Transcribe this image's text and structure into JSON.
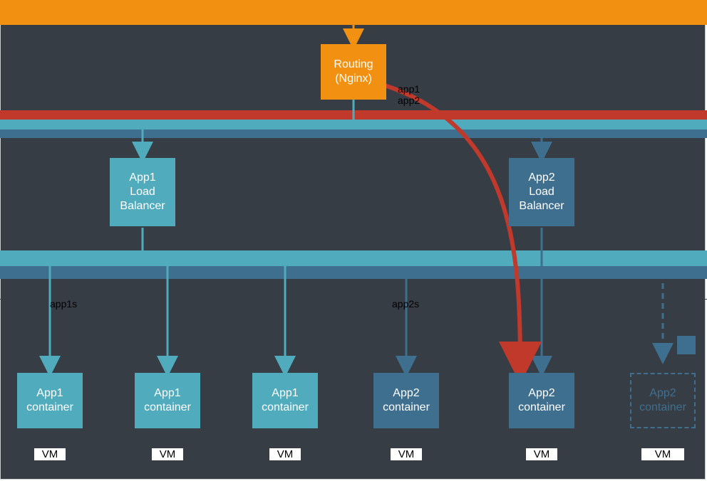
{
  "diagram": {
    "top_band": "",
    "routing": "Routing\n(Nginx)",
    "app1_lb": "App1\nLoad\nBalancer",
    "app2_lb": "App2\nLoad\nBalancer",
    "app1_container": "App1\ncontainer",
    "app2_container": "App2\ncontainer",
    "vm": "VM",
    "label_routing_right1": "app1",
    "label_routing_right2": "app2",
    "label_lb1_left": "app1s",
    "label_lb2_left": "app2s",
    "stripes": {
      "c1": "#50abbd",
      "c2": "#3f6f8f",
      "c3": "#c0392b"
    }
  },
  "chart_data": {
    "type": "diagram",
    "title": "Routing / Load-balancer / container topology",
    "nodes": [
      {
        "id": "routing",
        "label": "Routing (Nginx)",
        "color": "#f29111"
      },
      {
        "id": "app1_lb",
        "label": "App1 Load Balancer",
        "color": "#50abbd"
      },
      {
        "id": "app2_lb",
        "label": "App2 Load Balancer",
        "color": "#3f6f8f"
      },
      {
        "id": "app1_c1",
        "label": "App1 container",
        "vm": "VM",
        "color": "#50abbd"
      },
      {
        "id": "app1_c2",
        "label": "App1 container",
        "vm": "VM",
        "color": "#50abbd"
      },
      {
        "id": "app1_c3",
        "label": "App1 container",
        "vm": "VM",
        "color": "#50abbd"
      },
      {
        "id": "app2_c1",
        "label": "App2 container",
        "vm": "VM",
        "color": "#3f6f8f"
      },
      {
        "id": "app2_c2",
        "label": "App2 container",
        "vm": "VM",
        "color": "#3f6f8f"
      },
      {
        "id": "app2_c3",
        "label": "App2 container",
        "vm": "VM",
        "color": "#3f6f8f",
        "state": "pending"
      }
    ],
    "edges": [
      {
        "from": "routing",
        "to": "app1_lb",
        "color": "#50abbd"
      },
      {
        "from": "routing",
        "to": "app2_lb",
        "color": "#3f6f8f"
      },
      {
        "from": "routing",
        "to": "app2_c2",
        "color": "#c0392b",
        "style": "curve",
        "highlight": true
      },
      {
        "from": "app1_lb",
        "to": "app1_c1",
        "color": "#50abbd"
      },
      {
        "from": "app1_lb",
        "to": "app1_c2",
        "color": "#50abbd"
      },
      {
        "from": "app1_lb",
        "to": "app1_c3",
        "color": "#50abbd"
      },
      {
        "from": "app2_lb",
        "to": "app2_c1",
        "color": "#3f6f8f"
      },
      {
        "from": "app2_lb",
        "to": "app2_c2",
        "color": "#3f6f8f"
      },
      {
        "from": "app2_lb",
        "to": "app2_c3",
        "color": "#3f6f8f",
        "style": "dashed"
      }
    ],
    "annotations": [
      {
        "near": "routing",
        "text": "app1"
      },
      {
        "near": "routing",
        "text": "app2"
      },
      {
        "near": "app1_lb",
        "text": "app1s"
      },
      {
        "near": "app2_lb",
        "text": "app2s"
      }
    ]
  }
}
